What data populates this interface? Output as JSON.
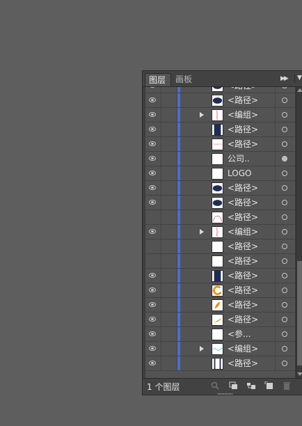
{
  "panel": {
    "tabs": [
      {
        "label": "图层",
        "active": true
      },
      {
        "label": "画板",
        "active": false
      }
    ],
    "collapse_icon": "double-chevron-right-icon",
    "menu_icon": "panel-menu-icon"
  },
  "layers": [
    {
      "visible": true,
      "expand": false,
      "thumb": "navy-ellipse",
      "label": "<路径>",
      "target": "empty"
    },
    {
      "visible": true,
      "expand": false,
      "thumb": "navy-ellipse",
      "label": "<路径>",
      "target": "empty"
    },
    {
      "visible": true,
      "expand": true,
      "thumb": "pink-figure",
      "label": "<编组>",
      "target": "empty"
    },
    {
      "visible": true,
      "expand": false,
      "thumb": "navy-rect",
      "label": "<路径>",
      "target": "empty"
    },
    {
      "visible": true,
      "expand": false,
      "thumb": "pink-line",
      "label": "<路径>",
      "target": "empty"
    },
    {
      "visible": true,
      "expand": false,
      "thumb": "blank",
      "label": "公司..",
      "target": "filled"
    },
    {
      "visible": true,
      "expand": false,
      "thumb": "blank",
      "label": "LOGO",
      "target": "empty"
    },
    {
      "visible": true,
      "expand": false,
      "thumb": "navy-ellipse",
      "label": "<路径>",
      "target": "empty"
    },
    {
      "visible": true,
      "expand": false,
      "thumb": "navy-ellipse",
      "label": "<路径>",
      "target": "empty"
    },
    {
      "visible": false,
      "expand": false,
      "thumb": "pink-arch",
      "label": "<路径>",
      "target": "empty"
    },
    {
      "visible": true,
      "expand": true,
      "thumb": "pink-figure",
      "label": "<编组>",
      "target": "empty"
    },
    {
      "visible": false,
      "expand": false,
      "thumb": "blank",
      "label": "<路径>",
      "target": "empty"
    },
    {
      "visible": false,
      "expand": false,
      "thumb": "blank",
      "label": "<路径>",
      "target": "empty"
    },
    {
      "visible": true,
      "expand": false,
      "thumb": "navy-rect",
      "label": "<路径>",
      "target": "empty"
    },
    {
      "visible": true,
      "expand": false,
      "thumb": "orange-ring",
      "label": "<路径>",
      "target": "empty"
    },
    {
      "visible": true,
      "expand": false,
      "thumb": "orange-leaf",
      "label": "<路径>",
      "target": "empty"
    },
    {
      "visible": true,
      "expand": false,
      "thumb": "orange-swoosh",
      "label": "<路径>",
      "target": "empty"
    },
    {
      "visible": true,
      "expand": false,
      "thumb": "blank",
      "label": "<参...",
      "target": "empty"
    },
    {
      "visible": true,
      "expand": true,
      "thumb": "blue-wave",
      "label": "<编组>",
      "target": "empty"
    },
    {
      "visible": true,
      "expand": false,
      "thumb": "navy-bars",
      "label": "<路径>",
      "target": "empty"
    }
  ],
  "footer": {
    "layer_count": "1 个图层",
    "buttons": [
      "locate-object-icon",
      "make-clipping-mask-icon",
      "new-sublayer-icon",
      "new-layer-icon",
      "delete-layer-icon"
    ]
  },
  "colors": {
    "background": "#5e5e5e",
    "panel": "#535353",
    "layer_color_bar": "#4b6fc9"
  }
}
